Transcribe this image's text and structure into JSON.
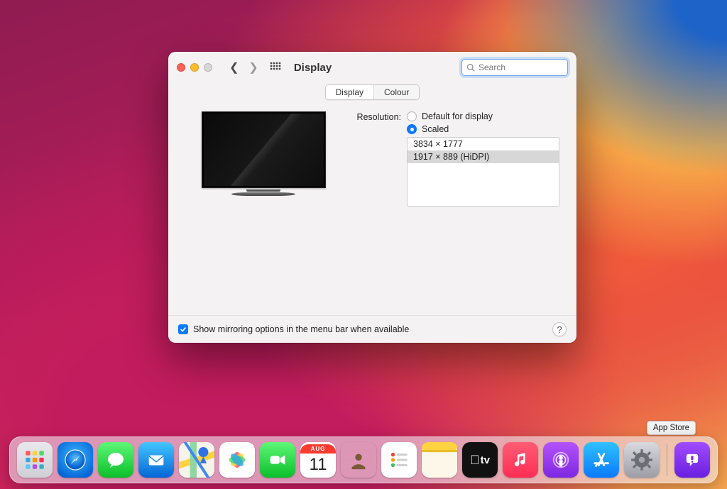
{
  "window": {
    "title": "Display",
    "search_placeholder": "Search",
    "tabs": {
      "display": "Display",
      "colour": "Colour"
    },
    "resolution_label": "Resolution:",
    "option_default": "Default for display",
    "option_scaled": "Scaled",
    "resolutions": [
      "3834 × 1777",
      "1917 × 889 (HiDPI)"
    ],
    "mirroring_label": "Show mirroring options in the menu bar when available",
    "help": "?"
  },
  "dock": {
    "tooltip": "App Store",
    "apps": [
      {
        "name": "launchpad"
      },
      {
        "name": "safari"
      },
      {
        "name": "messages"
      },
      {
        "name": "mail"
      },
      {
        "name": "maps"
      },
      {
        "name": "photos"
      },
      {
        "name": "facetime"
      },
      {
        "name": "calendar",
        "month": "AUG",
        "day": "11"
      },
      {
        "name": "contacts"
      },
      {
        "name": "reminders"
      },
      {
        "name": "notes"
      },
      {
        "name": "tv"
      },
      {
        "name": "music"
      },
      {
        "name": "podcasts"
      },
      {
        "name": "appstore"
      },
      {
        "name": "system-preferences"
      },
      {
        "name": "feedback"
      }
    ]
  }
}
